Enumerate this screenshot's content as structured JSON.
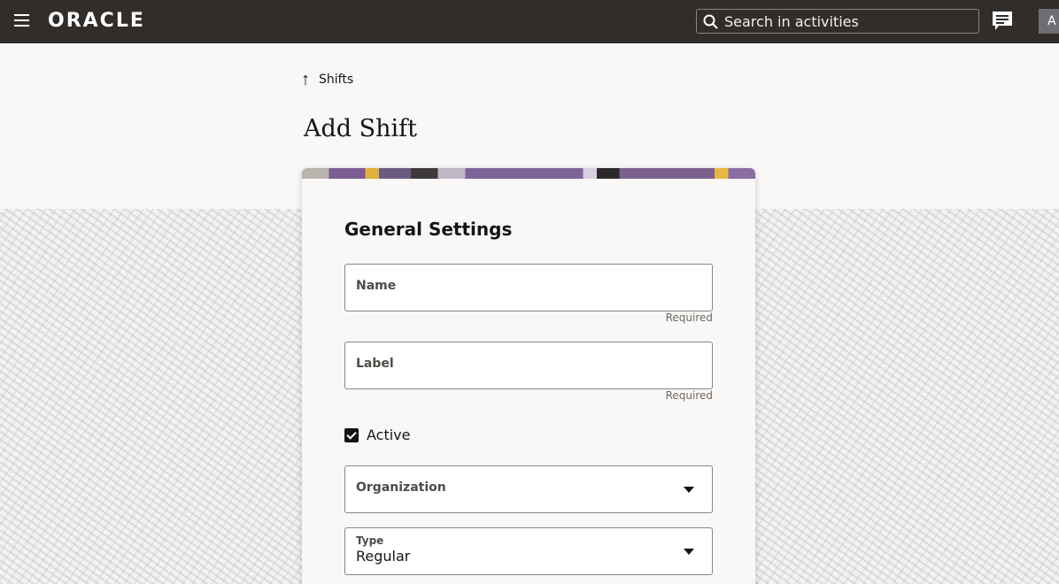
{
  "header": {
    "logo": "ORACLE",
    "search_placeholder": "Search in activities",
    "avatar_initial": "A"
  },
  "breadcrumb": {
    "back_label": "Shifts"
  },
  "page_title": "Add Shift",
  "form": {
    "section_title": "General Settings",
    "name": {
      "label": "Name",
      "value": "",
      "helper": "Required"
    },
    "label": {
      "label": "Label",
      "value": "",
      "helper": "Required"
    },
    "active": {
      "label": "Active",
      "checked": true
    },
    "organization": {
      "label": "Organization",
      "value": ""
    },
    "type": {
      "label": "Type",
      "value": "Regular"
    }
  },
  "colors": {
    "header_bg": "#312d2a",
    "page_bg": "#f9f8f7",
    "text": "#161513"
  }
}
